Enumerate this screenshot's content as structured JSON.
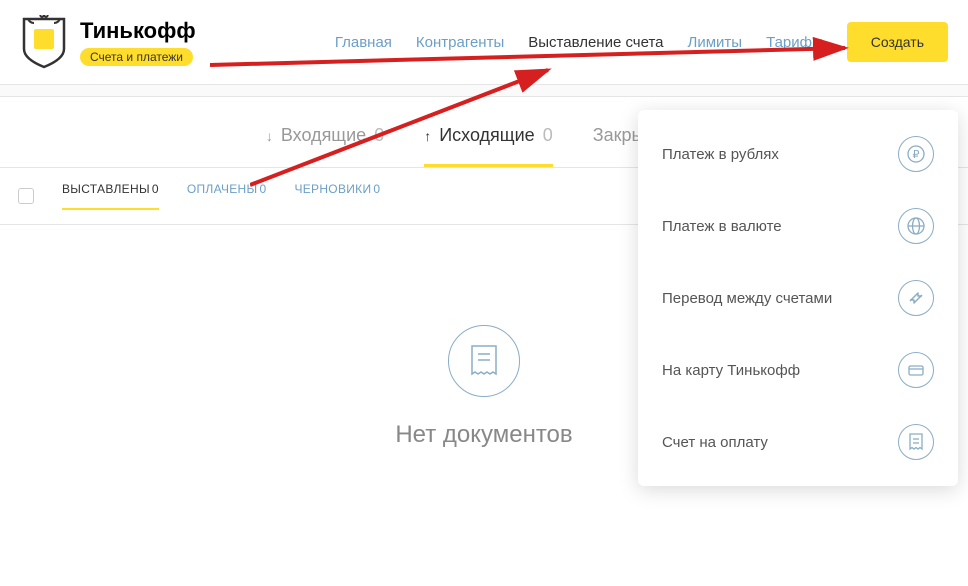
{
  "header": {
    "logo_title": "Тинькофф",
    "logo_badge": "Счета и платежи"
  },
  "nav": {
    "items": [
      {
        "label": "Главная"
      },
      {
        "label": "Контрагенты"
      },
      {
        "label": "Выставление счета"
      },
      {
        "label": "Лимиты"
      },
      {
        "label": "Тарифы"
      }
    ],
    "create_label": "Создать"
  },
  "tabs": {
    "incoming": {
      "label": "Входящие",
      "count": "0"
    },
    "outgoing": {
      "label": "Исходящие",
      "count": "0"
    },
    "closing": {
      "label": "Закрывающи"
    }
  },
  "subtabs": {
    "issued": {
      "label": "ВЫСТАВЛЕНЫ",
      "count": "0"
    },
    "paid": {
      "label": "ОПЛАЧЕНЫ",
      "count": "0"
    },
    "drafts": {
      "label": "ЧЕРНОВИКИ",
      "count": "0"
    }
  },
  "empty": {
    "title": "Нет документов"
  },
  "dropdown": {
    "items": [
      {
        "label": "Платеж в рублях",
        "icon": "ruble"
      },
      {
        "label": "Платеж в валюте",
        "icon": "globe"
      },
      {
        "label": "Перевод между счетами",
        "icon": "transfer"
      },
      {
        "label": "На карту Тинькофф",
        "icon": "card"
      },
      {
        "label": "Счет на оплату",
        "icon": "receipt"
      }
    ]
  }
}
